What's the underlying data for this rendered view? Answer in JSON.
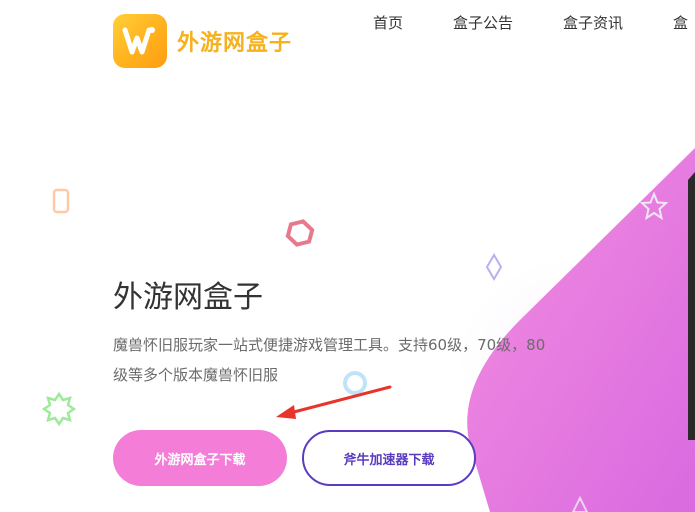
{
  "brand": {
    "name": "外游网盒子",
    "badge_color": "#ffb21d",
    "text_color": "#f5b21e"
  },
  "nav": {
    "items": [
      {
        "label": "首页"
      },
      {
        "label": "盒子公告"
      },
      {
        "label": "盒子资讯"
      },
      {
        "label": "盒"
      }
    ]
  },
  "hero": {
    "title": "外游网盒子",
    "description": "魔兽怀旧服玩家一站式便捷游戏管理工具。支持60级，70级，80级等多个版本魔兽怀旧服",
    "primary_button": "外游网盒子下载",
    "secondary_button": "斧牛加速器下载"
  },
  "colors": {
    "accent_pink": "#f47ed7",
    "accent_purple": "#5b3bbf",
    "arrow_red": "#e8342a"
  }
}
